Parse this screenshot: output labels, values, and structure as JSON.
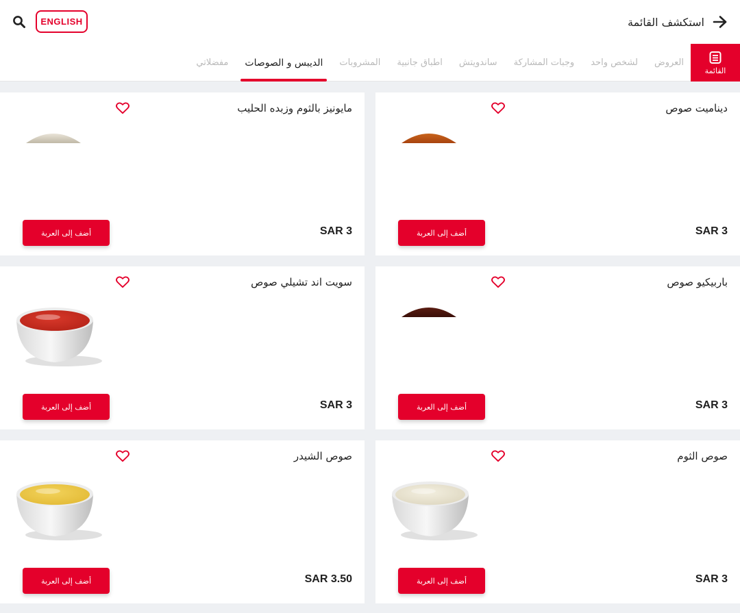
{
  "header": {
    "explore_label": "استكشف القائمة",
    "language_button": "ENGLISH"
  },
  "nav": {
    "menu_label": "القائمة",
    "tabs": [
      {
        "label": "العروض",
        "active": false
      },
      {
        "label": "لشخص واحد",
        "active": false
      },
      {
        "label": "وجبات المشاركة",
        "active": false
      },
      {
        "label": "ساندويتش",
        "active": false
      },
      {
        "label": "اطباق جانبية",
        "active": false
      },
      {
        "label": "المشروبات",
        "active": false
      },
      {
        "label": "الديبس و الصوصات",
        "active": true
      },
      {
        "label": "مفضلاتي",
        "active": false
      }
    ]
  },
  "products": [
    {
      "name": "ديناميت صوص",
      "price": "SAR 3",
      "add_label": "أضف إلى العربة",
      "sauce": "dynamite",
      "image_state": "partial"
    },
    {
      "name": "مايونيز بالثوم وزبده الحليب",
      "price": "SAR 3",
      "add_label": "أضف إلى العربة",
      "sauce": "garlic-mayo",
      "image_state": "partial"
    },
    {
      "name": "باربيكيو صوص",
      "price": "SAR 3",
      "add_label": "أضف إلى العربة",
      "sauce": "bbq",
      "image_state": "partial"
    },
    {
      "name": "سويت اند تشيلي صوص",
      "price": "SAR 3",
      "add_label": "أضف إلى العربة",
      "sauce": "sweet-chili",
      "image_state": "full"
    },
    {
      "name": "صوص الثوم",
      "price": "SAR 3",
      "add_label": "أضف إلى العربة",
      "sauce": "garlic",
      "image_state": "full"
    },
    {
      "name": "صوص الشيدر",
      "price": "SAR 3.50",
      "add_label": "أضف إلى العربة",
      "sauce": "cheddar",
      "image_state": "full"
    }
  ],
  "colors": {
    "accent": "#e4002b",
    "page_background": "#eef0f3",
    "card_background": "#ffffff",
    "tab_inactive": "#b9b9b9"
  },
  "icons": {
    "search": "search-icon",
    "back": "arrow-right-icon",
    "menu": "menu-list-icon",
    "favorite": "heart-outline-icon"
  }
}
